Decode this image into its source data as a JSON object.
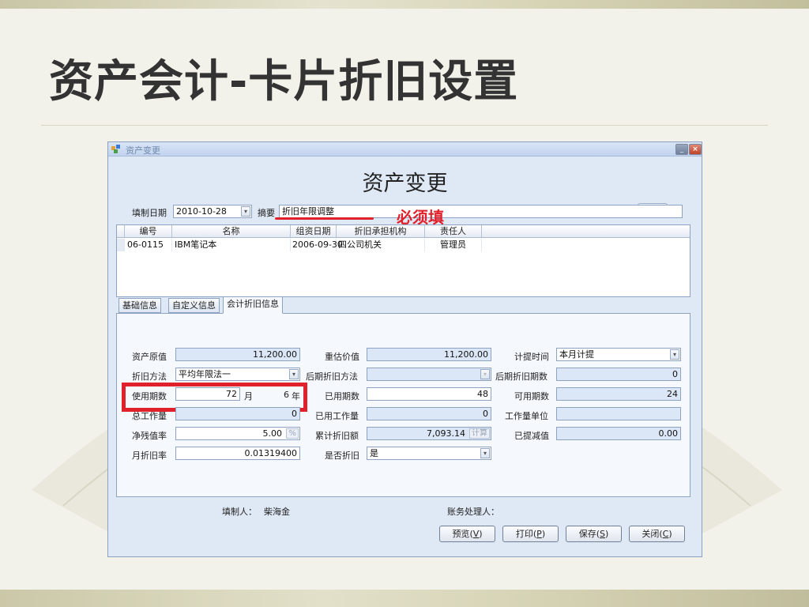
{
  "slide": {
    "title": "资产会计-卡片折旧设置"
  },
  "window": {
    "title": "资产变更",
    "heading": "资产变更",
    "min_glyph": "_",
    "close_glyph": "×"
  },
  "header": {
    "date_label": "填制日期",
    "date_value": "2010-10-28",
    "summary_label": "摘要",
    "summary_value": "折旧年限调整"
  },
  "annotation": {
    "text": "必须填",
    "color": "#e0212b"
  },
  "grid": {
    "columns": [
      "编号",
      "名称",
      "组资日期",
      "折旧承担机构",
      "责任人"
    ],
    "rows": [
      {
        "code": "06-0115",
        "name": "IBM笔记本",
        "date": "2006-09-30",
        "org": "四公司机关",
        "owner": "管理员"
      }
    ]
  },
  "tabs": [
    {
      "label": "基础信息",
      "active": false
    },
    {
      "label": "自定义信息",
      "active": false
    },
    {
      "label": "会计折旧信息",
      "active": true
    }
  ],
  "accounting": {
    "orig_value_label": "资产原值",
    "orig_value": "11,200.00",
    "revalue_label": "重估价值",
    "revalue": "11,200.00",
    "timing_label": "计提时间",
    "timing_value": "本月计提",
    "method_label": "折旧方法",
    "method_value": "平均年限法一",
    "later_method_label": "后期折旧方法",
    "later_method_value": "",
    "later_periods_label": "后期折旧期数",
    "later_periods": "0",
    "use_periods_label": "使用期数",
    "use_periods": "72",
    "month_unit": "月",
    "years": "6",
    "year_unit": "年",
    "used_periods_label": "已用期数",
    "used_periods": "48",
    "avail_periods_label": "可用期数",
    "avail_periods": "24",
    "total_work_label": "总工作量",
    "total_work": "0",
    "used_work_label": "已用工作量",
    "used_work": "0",
    "work_unit_label": "工作量单位",
    "work_unit": "",
    "salvage_rate_label": "净残值率",
    "salvage_rate": "5.00",
    "percent_btn": "%",
    "accum_dep_label": "累计折旧额",
    "accum_dep": "7,093.14",
    "calc_btn": "计算",
    "impairment_label": "已提减值",
    "impairment": "0.00",
    "monthly_rate_label": "月折旧率",
    "monthly_rate": "0.01319400",
    "is_dep_label": "是否折旧",
    "is_dep_value": "是"
  },
  "footer": {
    "preparer_label": "填制人：",
    "preparer": "柴海金",
    "handler_label": "账务处理人："
  },
  "buttons": {
    "preview": "预览",
    "preview_key": "V",
    "print": "打印",
    "print_key": "P",
    "save": "保存",
    "save_key": "S",
    "close": "关闭",
    "close_key": "C"
  },
  "icons": {
    "arrow": "▾"
  }
}
